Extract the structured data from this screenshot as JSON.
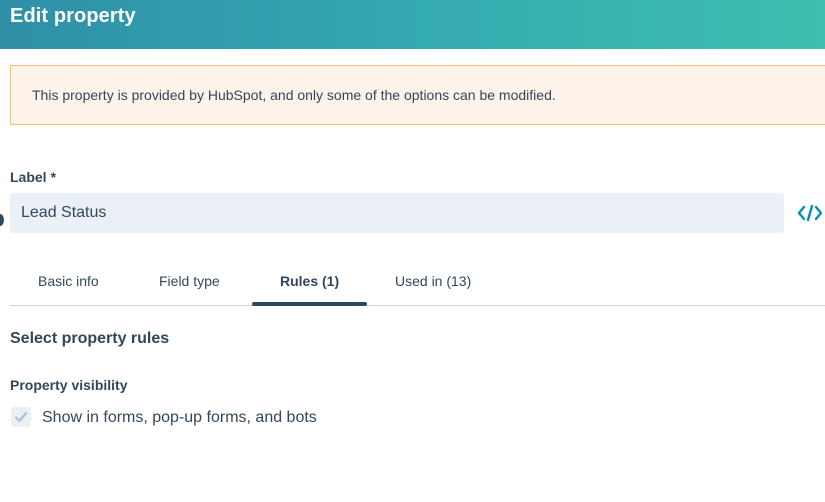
{
  "header": {
    "title": "Edit property"
  },
  "notice": {
    "text": "This property is provided by HubSpot, and only some of the options can be modified."
  },
  "label_field": {
    "label": "Label",
    "required_mark": "*",
    "value": "Lead Status"
  },
  "tabs": [
    {
      "label": "Basic info",
      "active": false
    },
    {
      "label": "Field type",
      "active": false
    },
    {
      "label": "Rules (1)",
      "active": true
    },
    {
      "label": "Used in (13)",
      "active": false
    }
  ],
  "rules": {
    "title": "Select property rules",
    "visibility_label": "Property visibility",
    "checkbox_label": "Show in forms, pop-up forms, and bots",
    "checkbox_checked": true
  },
  "colors": {
    "accent": "#0091ae",
    "text": "#33475b",
    "notice_border": "#f5c26b",
    "notice_bg": "#fdf3eb"
  },
  "icons": {
    "code": "code-icon",
    "check": "check-icon"
  }
}
